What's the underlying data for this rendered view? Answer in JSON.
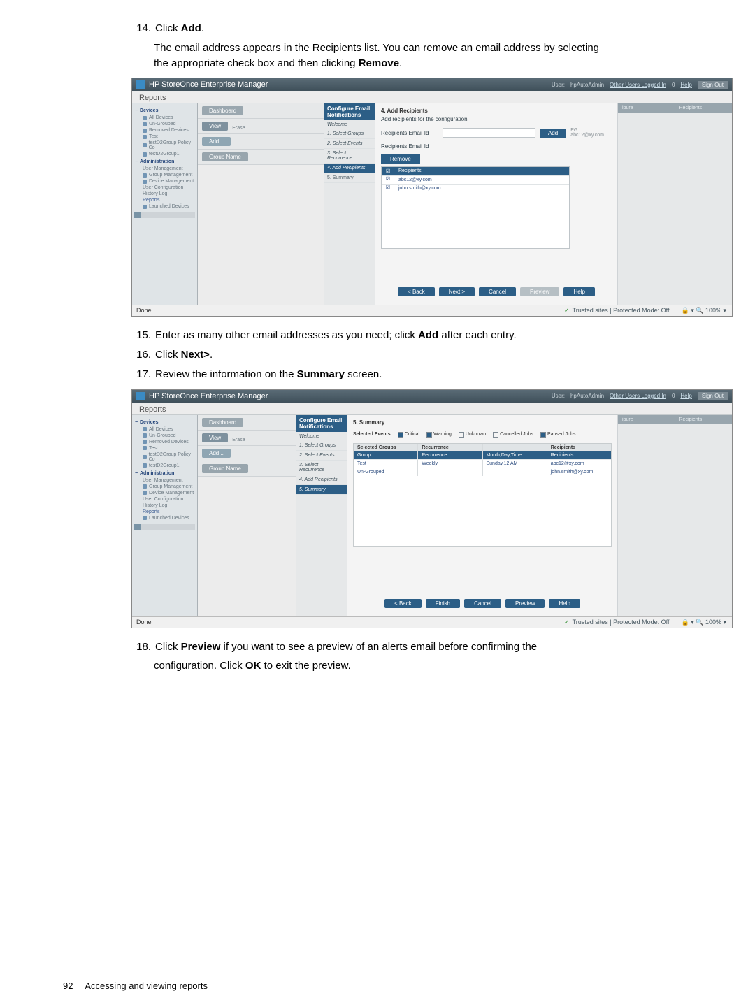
{
  "steps": {
    "s14_num": "14.",
    "s14": "Click ",
    "s14_b": "Add",
    "s14_end": ".",
    "s14_detail1": "The email address appears in the Recipients list. You can remove an email address by selecting",
    "s14_detail2a": "the appropriate check box and then clicking ",
    "s14_detail2b": "Remove",
    "s14_detail2c": ".",
    "s15_num": "15.",
    "s15a": "Enter as many other email addresses as you need; click ",
    "s15b": "Add",
    "s15c": " after each entry.",
    "s16_num": "16.",
    "s16a": "Click ",
    "s16b": "Next>",
    "s16c": ".",
    "s17_num": "17.",
    "s17a": "Review the information on the ",
    "s17b": "Summary",
    "s17c": " screen.",
    "s18_num": "18.",
    "s18a": "Click ",
    "s18b": "Preview",
    "s18c": " if you want to see a preview of an alerts email before confirming the",
    "s18d": "configuration. Click ",
    "s18e": "OK",
    "s18f": " to exit the preview."
  },
  "app": {
    "title": "HP StoreOnce Enterprise Manager",
    "user_label": "User:",
    "user": "hpAutoAdmin",
    "other_users": "Other Users Logged In",
    "other_users_count": "0",
    "help": "Help",
    "signout": "Sign Out",
    "tab_reports": "Reports",
    "toolbar": {
      "dashboard": "Dashboard",
      "view": "View",
      "erase": "Erase",
      "add": "Add...",
      "group_name": "Group Name"
    },
    "nav": {
      "devices": "Devices",
      "all_devices": "All Devices",
      "ungrouped": "Un-Grouped",
      "removed": "Removed Devices",
      "test": "Test",
      "policy": "testD2Group Policy Co",
      "group1": "testD2Group1",
      "administration": "Administration",
      "user_mgmt": "User Management",
      "group_mgmt": "Group Management",
      "device_mgmt": "Device Management",
      "user_config": "User Configuration",
      "history": "History Log",
      "reports": "Reports",
      "launched": "Launched Devices"
    },
    "wizard": {
      "header": "Configure Email Notifications",
      "welcome": "Welcome",
      "s1": "1. Select Groups",
      "s2": "2. Select Events",
      "s3": "3. Select Recurrence",
      "s4": "4. Add Recipients",
      "s5": "5. Summary"
    },
    "panel1": {
      "title": "4. Add Recipients",
      "sub": "Add recipients for the configuration",
      "email_label": "Recipients Email Id",
      "add": "Add",
      "eg": "EG: abc12@xy.com",
      "list_label": "Recipients Email Id",
      "remove": "Remove",
      "col_chk": "☑",
      "col_recipients": "Recipients",
      "r1": "abc12@xy.com",
      "r2": "john.smith@xy.com",
      "back": "< Back",
      "next": "Next >",
      "cancel": "Cancel",
      "preview": "Preview",
      "help": "Help"
    },
    "panel2": {
      "title": "5. Summary",
      "se_label": "Selected Events",
      "ev_critical": "Critical",
      "ev_warning": "Warning",
      "ev_unknown": "Unknown",
      "ev_cancelled": "Cancelled Jobs",
      "ev_paused": "Paused Jobs",
      "sg_label": "Selected Groups",
      "rec_label": "Recurrence",
      "rcp_label": "Recipients",
      "col_group": "Group",
      "col_recurrence": "Recurrence",
      "col_mdt": "Month,Day,Time",
      "col_recipients": "Recipients",
      "g1": "Test",
      "g1_rec": "Weekly",
      "g1_mdt": "Sunday,12 AM",
      "g1_rcp": "abc12@xy.com",
      "g2": "Un-Grouped",
      "g2_rcp": "john.smith@xy.com",
      "back": "< Back",
      "finish": "Finish",
      "cancel": "Cancel",
      "preview": "Preview",
      "help": "Help"
    },
    "right_cols": {
      "c1": "ipure",
      "c2": "Recipients"
    },
    "status": {
      "done": "Done",
      "trusted": "Trusted sites | Protected Mode: Off",
      "zoom": "100%"
    }
  },
  "footer": {
    "pgnum": "92",
    "title": "Accessing and viewing reports"
  }
}
